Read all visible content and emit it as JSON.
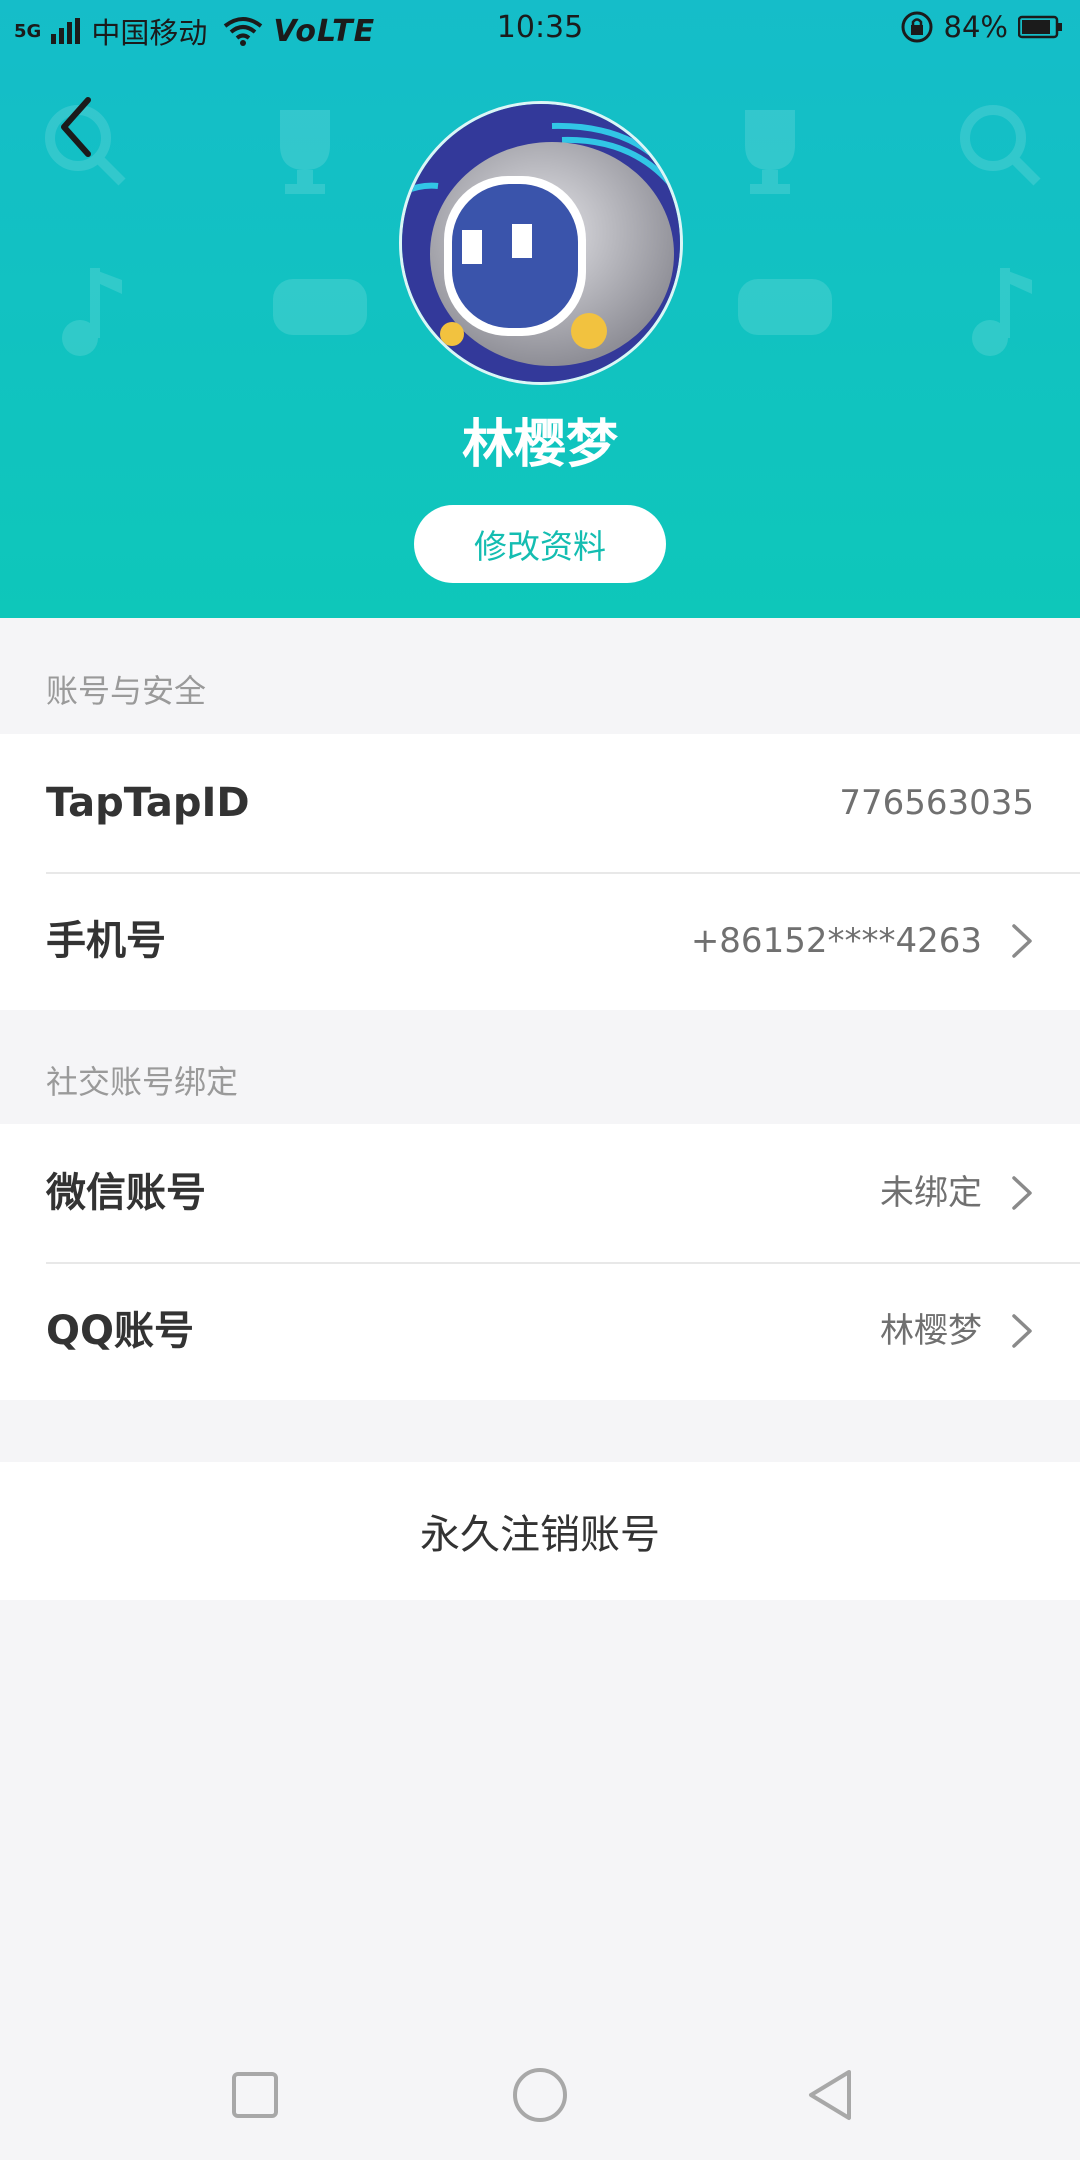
{
  "status_bar": {
    "signal": "5G",
    "carrier": "中国移动",
    "volte": "VoLTE",
    "time": "10:35",
    "battery": "84%"
  },
  "profile": {
    "nickname": "林樱梦",
    "edit_button": "修改资料"
  },
  "account_security": {
    "section_title": "账号与安全",
    "rows": [
      {
        "label": "TapTapID",
        "value": "776563035"
      },
      {
        "label": "手机号",
        "value": "+86152****4263"
      }
    ]
  },
  "social_binding": {
    "section_title": "社交账号绑定",
    "rows": [
      {
        "label": "微信账号",
        "value": "未绑定"
      },
      {
        "label": "QQ账号",
        "value": "林樱梦"
      }
    ]
  },
  "delete_account": "永久注销账号",
  "colors": {
    "header_top": "#15bdc9",
    "header_bottom": "#0ec7ba",
    "accent": "#14bdb1",
    "page_bg": "#f5f5f7"
  },
  "icons": [
    "wifi-icon",
    "rotation-lock-icon",
    "battery-icon",
    "back-arrow-icon",
    "chevron-right-icon",
    "nav-recent-icon",
    "nav-home-icon",
    "nav-back-icon"
  ]
}
